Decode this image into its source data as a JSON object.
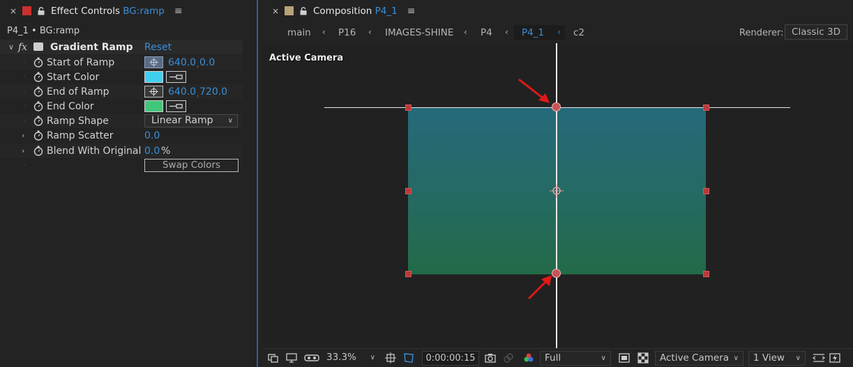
{
  "effect_panel": {
    "tab_close": "×",
    "tab_title": "Effect Controls",
    "tab_layer": "BG:ramp",
    "swatch_color": "#c9302f",
    "subtitle": "P4_1 • BG:ramp",
    "effect": {
      "name": "Gradient Ramp",
      "fx_label": "fx",
      "reset_label": "Reset"
    },
    "properties": {
      "start_of_ramp": {
        "label": "Start of Ramp",
        "x": "640.0",
        "y": "0.0"
      },
      "start_color": {
        "label": "Start Color",
        "color": "#3fd0f0"
      },
      "end_of_ramp": {
        "label": "End of Ramp",
        "x": "640.0",
        "y": "720.0"
      },
      "end_color": {
        "label": "End Color",
        "color": "#41c77a"
      },
      "ramp_shape": {
        "label": "Ramp Shape",
        "value": "Linear Ramp"
      },
      "ramp_scatter": {
        "label": "Ramp Scatter",
        "value": "0.0"
      },
      "blend_with_original": {
        "label": "Blend With Original",
        "value": "0.0",
        "unit": "%"
      },
      "swap_colors": {
        "label": "Swap Colors"
      }
    }
  },
  "comp_panel": {
    "tab_close": "×",
    "tab_title": "Composition",
    "tab_comp": "P4_1",
    "swatch_color": "#b9a27a",
    "breadcrumbs": [
      "main",
      "P16",
      "IMAGES-SHINE",
      "P4",
      "P4_1",
      "c2"
    ],
    "active_breadcrumb": "P4_1",
    "renderer_label": "Renderer:",
    "renderer_value": "Classic 3D",
    "viewer_label": "Active Camera",
    "gradient_top_color": "#256a7a",
    "gradient_bottom_color": "#236a48",
    "toolbar": {
      "zoom": "33.3%",
      "timecode": "0:00:00:15",
      "resolution": "Full",
      "camera": "Active Camera",
      "views": "1 View"
    }
  }
}
